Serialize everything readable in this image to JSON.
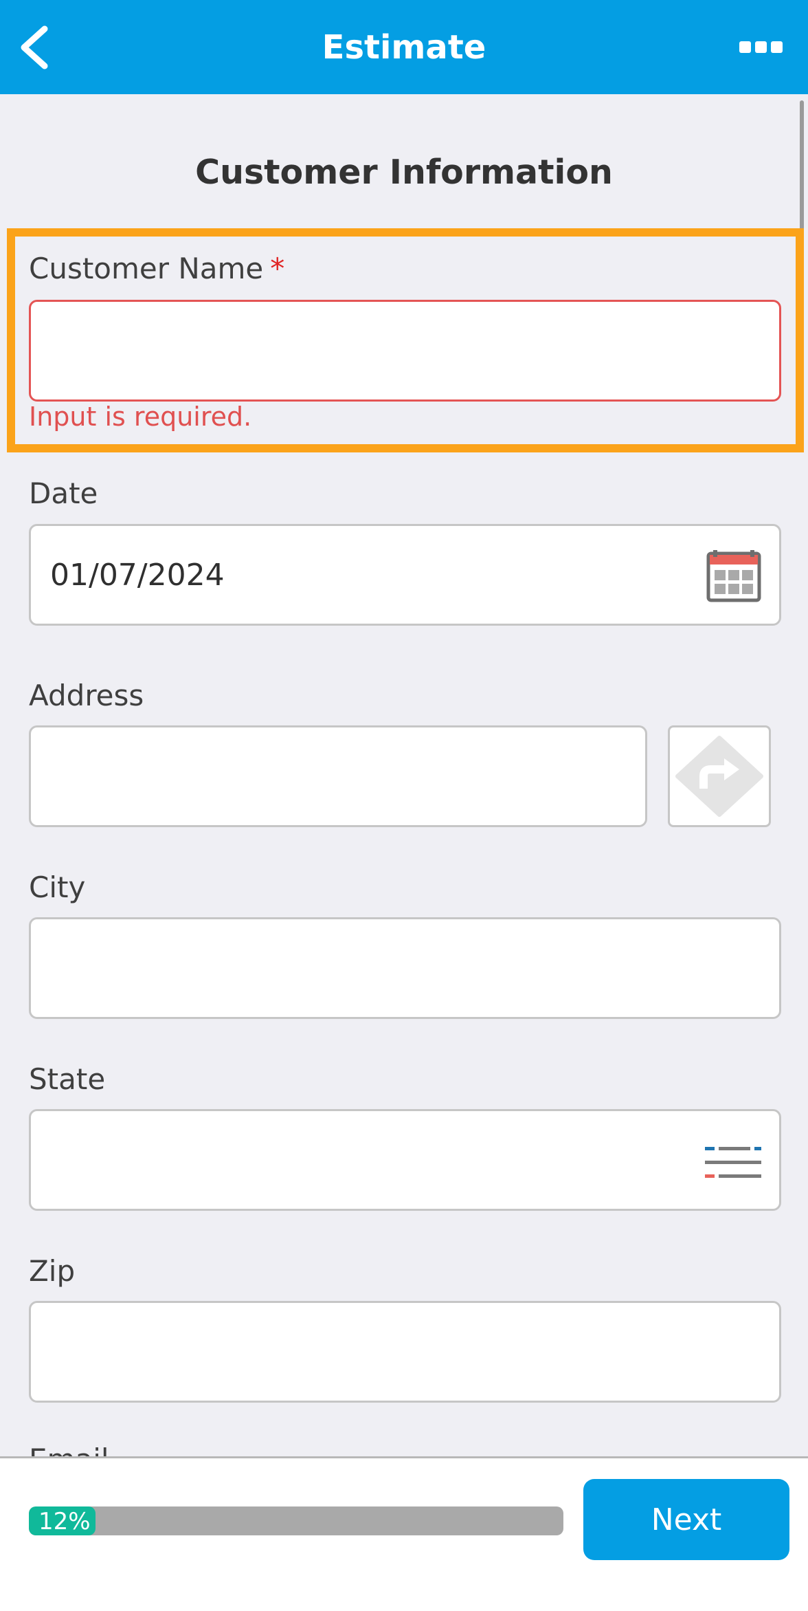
{
  "header": {
    "title": "Estimate"
  },
  "form": {
    "section_title": "Customer Information",
    "customer_name": {
      "label": "Customer Name",
      "required_mark": "*",
      "value": "",
      "error": "Input is required."
    },
    "date": {
      "label": "Date",
      "value": "01/07/2024"
    },
    "address": {
      "label": "Address",
      "value": ""
    },
    "city": {
      "label": "City",
      "value": ""
    },
    "state": {
      "label": "State",
      "value": ""
    },
    "zip": {
      "label": "Zip",
      "value": ""
    },
    "email": {
      "label": "Email"
    }
  },
  "footer": {
    "progress_label": "12%",
    "progress_value": 0.12,
    "next_label": "Next"
  },
  "icons": {
    "back": "chevron-left-icon",
    "more": "more-horizontal-icon",
    "calendar": "calendar-icon",
    "directions": "directions-icon",
    "list": "list-icon"
  },
  "colors": {
    "header": "#049ee3",
    "highlight": "#fba31a",
    "error": "#e05050",
    "progress_fill": "#10b99a"
  }
}
